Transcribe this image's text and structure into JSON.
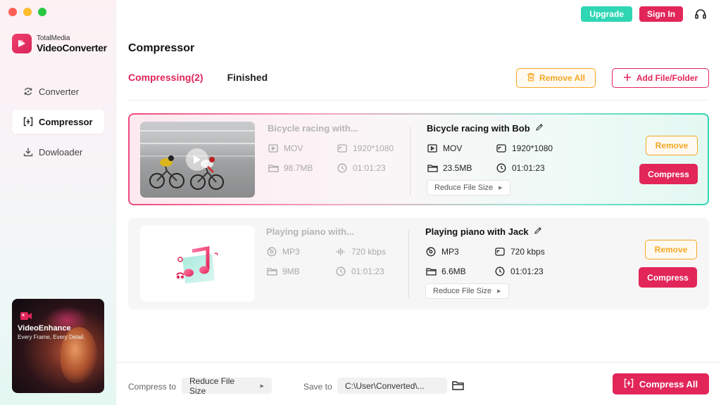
{
  "window": {
    "controls": [
      "close",
      "minimize",
      "maximize"
    ]
  },
  "brand": {
    "line1": "TotalMedia",
    "line2": "VideoConverter",
    "accent": "#e2265a",
    "secondary": "#2fd6b4"
  },
  "sidebar": {
    "items": [
      {
        "label": "Converter",
        "icon": "refresh-icon",
        "active": false
      },
      {
        "label": "Compressor",
        "icon": "compress-icon",
        "active": true
      },
      {
        "label": "Dowloader",
        "icon": "download-icon",
        "active": false
      }
    ],
    "promo": {
      "title": "VideoEnhance",
      "subtitle": "Every Frame, Every Detail."
    }
  },
  "topbar": {
    "upgrade_label": "Upgrade",
    "signin_label": "Sign In",
    "support_icon": "headset-icon"
  },
  "page": {
    "title": "Compressor"
  },
  "tabs": [
    {
      "label": "Compressing(2)",
      "active": true
    },
    {
      "label": "Finished",
      "active": false
    }
  ],
  "actions": {
    "remove_all_label": "Remove All",
    "add_label": "Add File/Folder"
  },
  "files": [
    {
      "thumbnail": "video",
      "source": {
        "title": "Bicycle racing with...",
        "format": "MOV",
        "resolution": "1920*1080",
        "size": "98.7MB",
        "duration": "01:01:23"
      },
      "output": {
        "title": "Bicycle racing with Bob",
        "format": "MOV",
        "resolution": "1920*1080",
        "size": "23.5MB",
        "duration": "01:01:23",
        "mode": "Reduce File Size"
      },
      "remove_label": "Remove",
      "compress_label": "Compress"
    },
    {
      "thumbnail": "audio",
      "source": {
        "title": "Playing piano with...",
        "format": "MP3",
        "bitrate": "720 kbps",
        "size": "9MB",
        "duration": "01:01:23"
      },
      "output": {
        "title": "Playing piano with Jack",
        "format": "MP3",
        "bitrate": "720 kbps",
        "size": "6.6MB",
        "duration": "01:01:23",
        "mode": "Reduce File Size"
      },
      "remove_label": "Remove",
      "compress_label": "Compress"
    }
  ],
  "bottom": {
    "compress_to_label": "Compress to",
    "compress_to_value": "Reduce File Size",
    "save_to_label": "Save to",
    "save_to_value": "C:\\User\\Converted\\...",
    "compress_all_label": "Compress All"
  }
}
